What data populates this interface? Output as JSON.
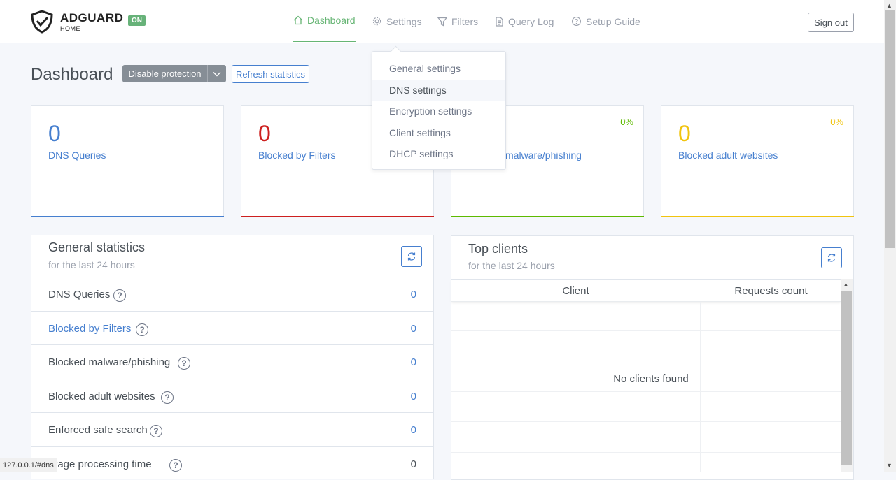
{
  "header": {
    "brand": "ADGUARD",
    "brand_sub": "HOME",
    "status_badge": "ON",
    "nav": {
      "dashboard": "Dashboard",
      "settings": "Settings",
      "filters": "Filters",
      "query_log": "Query Log",
      "setup_guide": "Setup Guide"
    },
    "sign_out": "Sign out"
  },
  "settings_dropdown": {
    "items": [
      "General settings",
      "DNS settings",
      "Encryption settings",
      "Client settings",
      "DHCP settings"
    ],
    "hovered": "DNS settings"
  },
  "page": {
    "title": "Dashboard",
    "disable_protection": "Disable protection",
    "refresh_statistics": "Refresh statistics"
  },
  "cards": [
    {
      "value": "0",
      "label": "DNS Queries",
      "percent": "",
      "color": "#467fcf"
    },
    {
      "value": "0",
      "label": "Blocked by Filters",
      "percent": "",
      "color": "#cd201f"
    },
    {
      "value": "",
      "label": "malware/phishing",
      "percent": "0%",
      "color": "#5eba00"
    },
    {
      "value": "0",
      "label": "Blocked adult websites",
      "percent": "0%",
      "color": "#f1c40f"
    }
  ],
  "general_statistics": {
    "title": "General statistics",
    "subtitle": "for the last 24 hours",
    "rows": [
      {
        "name": "DNS Queries",
        "value": "0"
      },
      {
        "name": "Blocked by Filters",
        "value": "0"
      },
      {
        "name": "Blocked malware/phishing",
        "value": "0"
      },
      {
        "name": "Blocked adult websites",
        "value": "0"
      },
      {
        "name": "Enforced safe search",
        "value": "0"
      },
      {
        "name": "erage processing time",
        "value": "0"
      }
    ]
  },
  "top_clients": {
    "title": "Top clients",
    "subtitle": "for the last 24 hours",
    "columns": [
      "Client",
      "Requests count"
    ],
    "empty_text": "No clients found"
  },
  "status_bar": "127.0.0.1/#dns"
}
